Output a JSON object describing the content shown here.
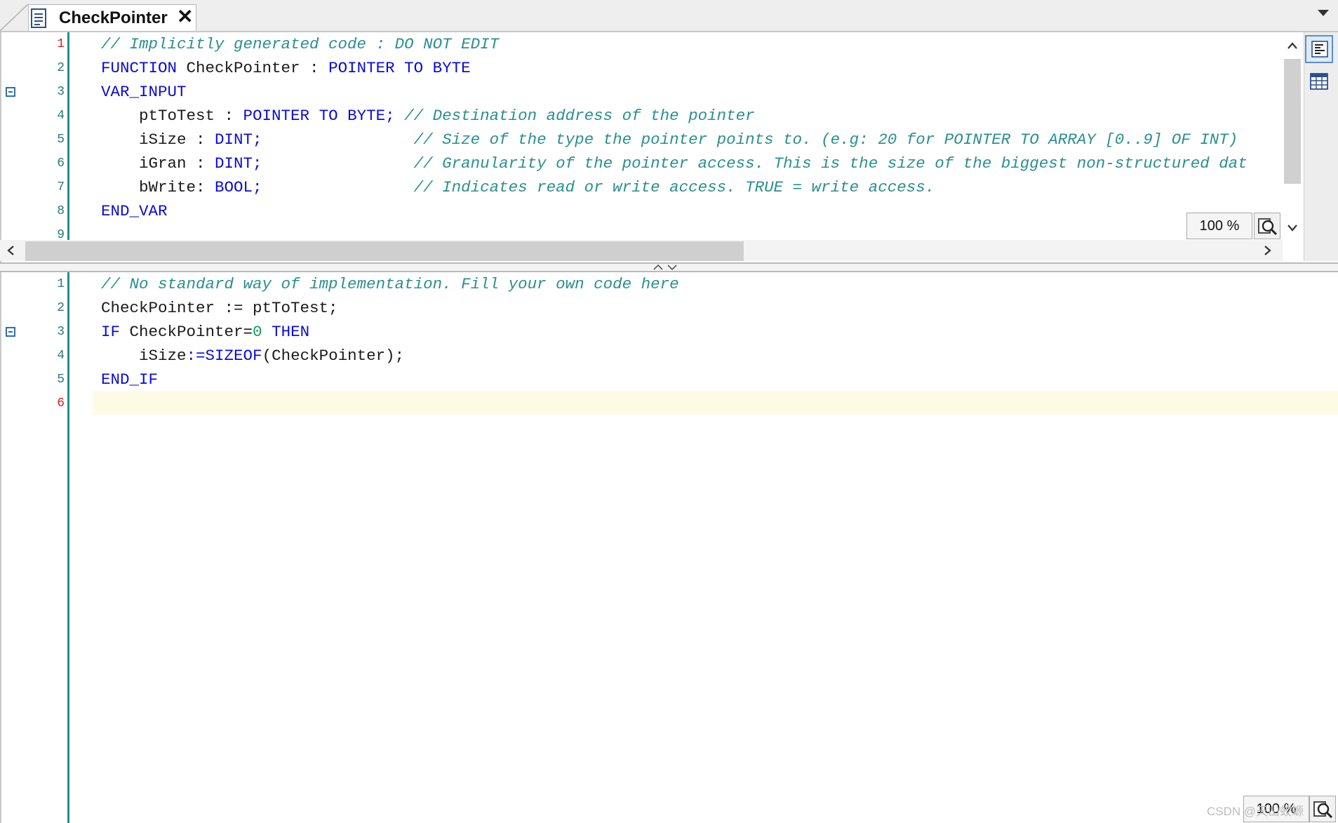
{
  "tab": {
    "title": "CheckPointer",
    "close_icon": "close-icon",
    "doc_icon": "document-icon"
  },
  "decl": {
    "line_numbers": [
      "1",
      "2",
      "3",
      "4",
      "5",
      "6",
      "7",
      "8",
      "9"
    ],
    "line1_comment": "// Implicitly generated code : DO NOT EDIT",
    "line2_kw1": "FUNCTION",
    "line2_name": " CheckPointer : ",
    "line2_kw2": "POINTER TO BYTE",
    "line3_kw": "VAR_INPUT",
    "line4_name": "    ptToTest : ",
    "line4_kw": "POINTER TO BYTE;",
    "line4_comment": " // Destination address of the pointer",
    "line5_name": "    iSize : ",
    "line5_kw": "DINT;",
    "line5_comment": "                // Size of the type the pointer points to. (e.g: 20 for POINTER TO ARRAY [0..9] OF INT)",
    "line6_name": "    iGran : ",
    "line6_kw": "DINT;",
    "line6_comment": "                // Granularity of the pointer access. This is the size of the biggest non-structured dat",
    "line7_name": "    bWrite: ",
    "line7_kw": "BOOL;",
    "line7_comment": "                // Indicates read or write access. TRUE = write access.",
    "line8_kw": "END_VAR",
    "zoom": "100 %"
  },
  "impl": {
    "line_numbers": [
      "1",
      "2",
      "3",
      "4",
      "5",
      "6"
    ],
    "line1_comment": "// No standard way of implementation. Fill your own code here",
    "line2_code": "CheckPointer := ptToTest;",
    "line3_kw1": "IF",
    "line3_name": " CheckPointer=",
    "line3_num": "0",
    "line3_kw2": " THEN",
    "line4_name": "    iSize",
    "line4_kw": ":=SIZEOF",
    "line4_rest": "(CheckPointer);",
    "line5_kw": "END_IF",
    "zoom": "100 %"
  },
  "watermark": "CSDN @天山蛟螈",
  "colors": {
    "keyword": "#0b0bd6",
    "comment": "#2a8f8f",
    "gutter": "#2a8a8a",
    "current_line": "#fdfbe3"
  }
}
